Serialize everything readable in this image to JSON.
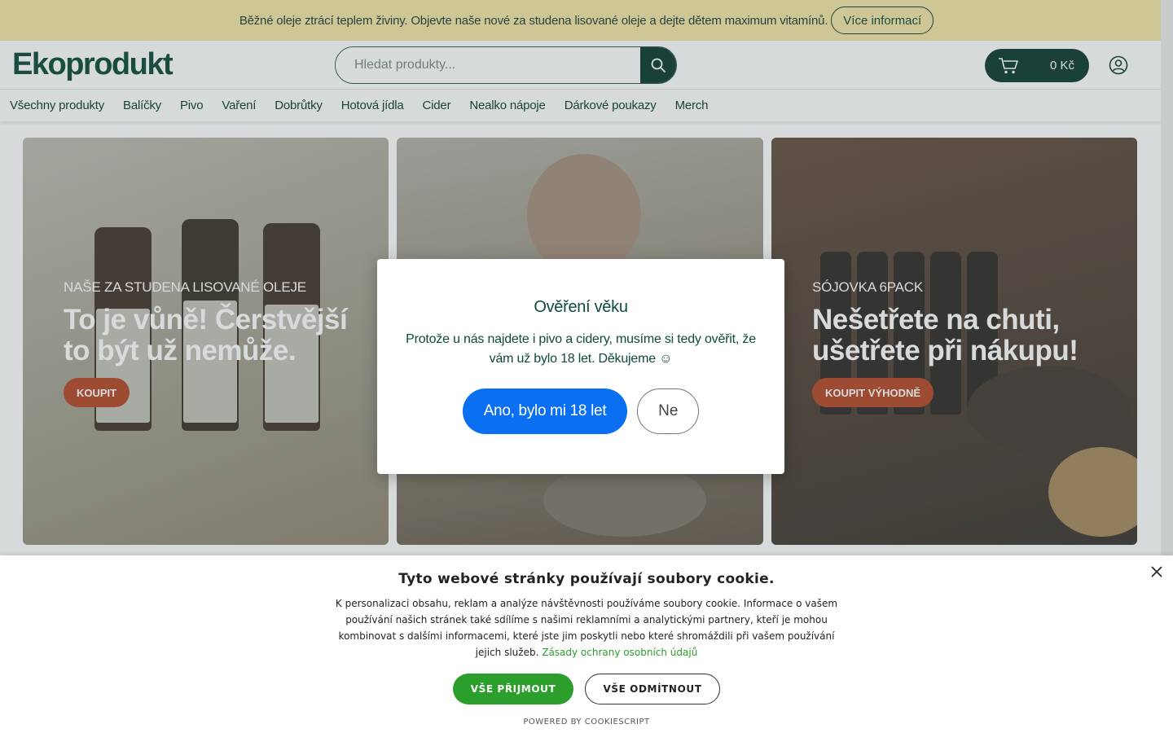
{
  "announcement": {
    "text": "Běžné oleje ztrácí teplem živiny. Objevte naše nové za studena lisované oleje a dejte dětem maximum vitamínů.",
    "button": "Více informací"
  },
  "header": {
    "logo": "Ekoprodukt",
    "search_placeholder": "Hledat produkty...",
    "cart_total": "0 Kč"
  },
  "nav": {
    "items": [
      "Všechny produkty",
      "Balíčky",
      "Pivo",
      "Vaření",
      "Dobrůtky",
      "Hotová jídla",
      "Cider",
      "Nealko nápoje",
      "Dárkové poukazy",
      "Merch"
    ]
  },
  "banners": [
    {
      "subtitle": "Naše za studena lisované oleje",
      "title": "To je vůně! Čerstvější to být už nemůže.",
      "button": "Koupit"
    },
    {
      "subtitle": "",
      "title": "",
      "button": ""
    },
    {
      "subtitle": "Sójovka 6pack",
      "title": "Nešetřete na chuti, ušetřete při nákupu!",
      "button": "Koupit výhodně"
    }
  ],
  "age_modal": {
    "title": "Ověření věku",
    "text": "Protože u nás najdete i pivo a cidery, musíme si tedy ověřit, že vám už bylo 18 let. Děkujeme ☺",
    "yes": "Ano, bylo mi 18 let",
    "no": "Ne"
  },
  "cookie": {
    "title": "Tyto webové stránky používají soubory cookie.",
    "text": "K personalizaci obsahu, reklam a analýze návštěvnosti používáme soubory cookie. Informace o vašem používání našich stránek také sdílíme s našimi reklamními a analytickými partnery, kteří je mohou kombinovat s dalšími informacemi, které jste jim poskytli nebo které shromáždili při vašem používání jejich služeb.",
    "link": "Zásady ochrany osobních údajů",
    "accept": "Vše přijmout",
    "reject": "Vše odmítnout",
    "powered": "Powered by CookieScript"
  },
  "colors": {
    "brand_green": "#0d3b31",
    "announcement_bg": "#f5e6a8",
    "cta_orange": "#b54a2a",
    "confirm_blue": "#0a6ff0",
    "cookie_green": "#2b9e2b"
  },
  "icons": [
    "search-icon",
    "cart-icon",
    "account-icon",
    "close-icon"
  ]
}
